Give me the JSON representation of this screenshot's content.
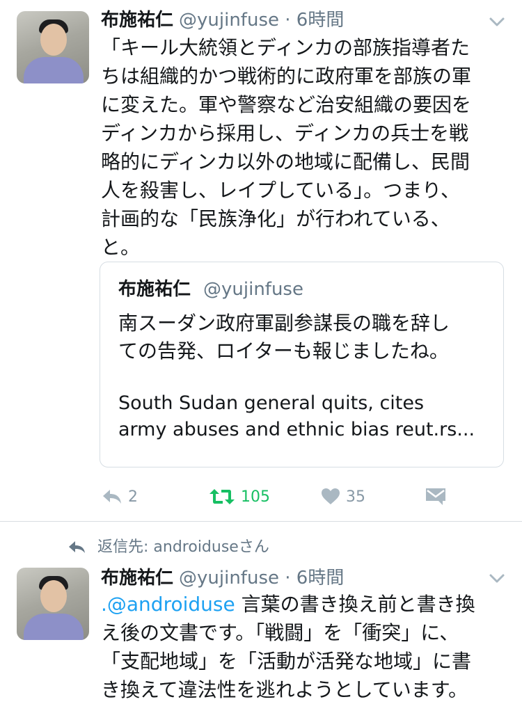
{
  "tweets": [
    {
      "author_name": "布施祐仁",
      "author_handle": "@yujinfuse",
      "time": "6時間",
      "text": "「キール大統領とディンカの部族指導者た\nちは組織的かつ戦術的に政府軍を部族の軍\nに変えた。軍や警察など治安組織の要因を\nディンカから採用し、ディンカの兵士を戦\n略的にディンカ以外の地域に配備し、民間\n人を殺害し、レイプしている」。つまり、\n計画的な「民族浄化」が行われている、\nと。",
      "quoted": {
        "author_name": "布施祐仁",
        "author_handle": "@yujinfuse",
        "text": "南スーダン政府軍副参謀長の職を辞し\nての告発、ロイターも報じましたね。",
        "english": "South Sudan general quits, cites\narmy abuses and ethnic bias reut.rs..."
      },
      "actions": {
        "reply_count": "2",
        "retweet_count": "105",
        "like_count": "35"
      },
      "colors": {
        "retweet_active": "#17bf63",
        "inactive": "#aab8c2"
      }
    },
    {
      "reply_to_label": "返信先: androiduseさん",
      "author_name": "布施祐仁",
      "author_handle": "@yujinfuse",
      "time": "6時間",
      "mention": ".@androiduse",
      "text": " 言葉の書き換え前と書き換\nえ後の文書です。「戦闘」を「衝突」に、\n「支配地域」を「活動が活発な地域」に書\nき換えて違法性を逃れようとしています。"
    }
  ],
  "icons": [
    "chevron-down-icon",
    "reply-icon",
    "retweet-icon",
    "heart-icon",
    "direct-message-icon",
    "reply-arrow-icon"
  ]
}
